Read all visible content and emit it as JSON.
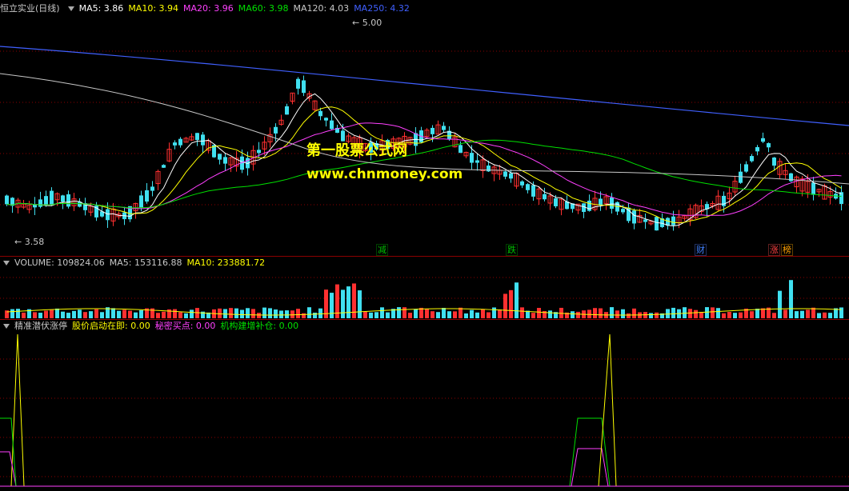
{
  "main": {
    "title": "恒立实业(日线)",
    "ma": [
      {
        "label": "MA5: 3.86",
        "color": "#ffffff"
      },
      {
        "label": "MA10: 3.94",
        "color": "#ffff00"
      },
      {
        "label": "MA20: 3.96",
        "color": "#ff40ff"
      },
      {
        "label": "MA60: 3.98",
        "color": "#00e000"
      },
      {
        "label": "MA120: 4.03",
        "color": "#c8c8c8"
      },
      {
        "label": "MA250: 4.32",
        "color": "#4060ff"
      }
    ],
    "high_label": "5.00",
    "low_label": "3.58",
    "markers": [
      {
        "text": "减",
        "color": "#00c000"
      },
      {
        "text": "跌",
        "color": "#00c000"
      },
      {
        "text": "财",
        "color": "#4080ff"
      },
      {
        "text": "涨",
        "color": "#ff4040"
      },
      {
        "text": "榜",
        "color": "#ffa000"
      }
    ]
  },
  "watermark": {
    "line1": "第一股票公式网",
    "line2": "www.chnmoney.com"
  },
  "volume": {
    "labels": [
      {
        "label": "VOLUME: 109824.06",
        "color": "#c8c8c8"
      },
      {
        "label": "MA5: 153116.88",
        "color": "#c8c8c8"
      },
      {
        "label": "MA10: 233881.72",
        "color": "#ffff00"
      }
    ]
  },
  "indicator": {
    "labels": [
      {
        "label": "精准潜伏涨停",
        "color": "#c8c8c8"
      },
      {
        "label": "股价启动在即: 0.00",
        "color": "#ffff00"
      },
      {
        "label": "秘密买点: 0.00",
        "color": "#ff40ff"
      },
      {
        "label": "机构建增补仓: 0.00",
        "color": "#00e000"
      }
    ]
  },
  "colors": {
    "up": "#ff3030",
    "down": "#40e0f0",
    "grid": "#8b0000"
  }
}
